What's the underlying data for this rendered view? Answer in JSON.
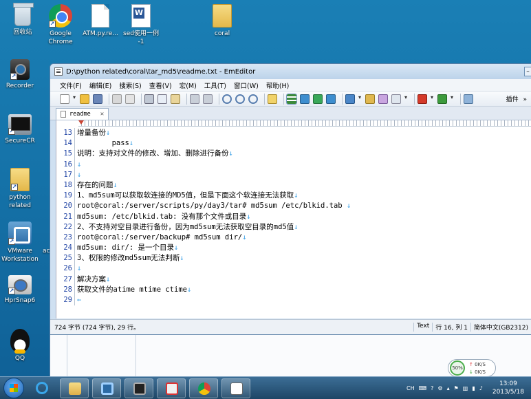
{
  "desktop": {
    "icons": [
      {
        "id": "recycle-bin",
        "label": "回收站",
        "icon": "recycle-bin-icon"
      },
      {
        "id": "chrome",
        "label": "Google\nChrome",
        "icon": "chrome-icon"
      },
      {
        "id": "atm",
        "label": "ATM.py.re...",
        "icon": "document-icon"
      },
      {
        "id": "sed",
        "label": "sed使用一例\n-1",
        "icon": "word-document-icon"
      },
      {
        "id": "coral",
        "label": "coral",
        "icon": "folder-icon"
      },
      {
        "id": "recorder",
        "label": "Recorder",
        "icon": "camcorder-icon"
      },
      {
        "id": "securecrt",
        "label": "SecureCR",
        "icon": "terminal-icon"
      },
      {
        "id": "python",
        "label": "python\nrelated",
        "icon": "folder-icon"
      },
      {
        "id": "vmware",
        "label": "VMware\nWorkstation",
        "icon": "vmware-icon"
      },
      {
        "id": "hprsnap",
        "label": "HprSnap6",
        "icon": "camera-icon"
      },
      {
        "id": "qq",
        "label": "QQ",
        "icon": "penguin-icon"
      }
    ],
    "partial_label": "ac"
  },
  "editor_window": {
    "title": "D:\\python related\\coral\\tar_md5\\readme.txt - EmEditor",
    "menu": [
      "文件(F)",
      "编辑(E)",
      "搜索(S)",
      "查看(V)",
      "宏(M)",
      "工具(T)",
      "窗口(W)",
      "帮助(H)"
    ],
    "toolbar_plugins_label": "插件",
    "overflow_chevron": "»",
    "tab": {
      "label": "readme",
      "close": "✕"
    },
    "lines": [
      {
        "n": "13",
        "text": "增量备份",
        "eol": "↓"
      },
      {
        "n": "14",
        "text": "        pass",
        "eol": "↓"
      },
      {
        "n": "15",
        "text": "说明：支持对文件的修改、增加、删除进行备份",
        "eol": "↓"
      },
      {
        "n": "16",
        "text": "",
        "eol": "↓"
      },
      {
        "n": "17",
        "text": "",
        "eol": "↓"
      },
      {
        "n": "18",
        "text": "存在的问题",
        "eol": "↓"
      },
      {
        "n": "19",
        "text": "1、md5sum可以获取软连接的MD5值，但是下面这个软连接无法获取",
        "eol": "↓"
      },
      {
        "n": "20",
        "text": "root@coral:/server/scripts/py/day3/tar# md5sum /etc/blkid.tab ",
        "eol": "↓"
      },
      {
        "n": "21",
        "text": "md5sum: /etc/blkid.tab: 没有那个文件或目录",
        "eol": "↓"
      },
      {
        "n": "22",
        "text": "2、不支持对空目录进行备份，因为md5sum无法获取空目录的md5值",
        "eol": "↓"
      },
      {
        "n": "23",
        "text": "root@coral:/server/backup# md5sum dir/",
        "eol": "↓"
      },
      {
        "n": "24",
        "text": "md5sum: dir/: 是一个目录",
        "eol": "↓"
      },
      {
        "n": "25",
        "text": "3、权限的修改md5sum无法判断",
        "eol": "↓"
      },
      {
        "n": "26",
        "text": "",
        "eol": "↓"
      },
      {
        "n": "27",
        "text": "解决方案",
        "eol": "↓"
      },
      {
        "n": "28",
        "text": "获取文件的atime mtime ctime",
        "eol": "↓"
      },
      {
        "n": "29",
        "text": "",
        "eol": "←"
      }
    ],
    "status": {
      "left": "724 字节 (724 字节), 29 行。",
      "mode": "Text",
      "position": "行 16, 列 1",
      "encoding": "简体中文(GB2312)"
    }
  },
  "net_widget": {
    "percent": "50%",
    "up": "0K/S",
    "down": "0K/S"
  },
  "taskbar": {
    "buttons": [
      {
        "id": "ie",
        "icon": "internet-explorer-icon",
        "open": false
      },
      {
        "id": "explorer",
        "icon": "folder-icon",
        "open": true
      },
      {
        "id": "vmware",
        "icon": "vmware-icon",
        "open": true
      },
      {
        "id": "securecrt",
        "icon": "terminal-icon",
        "open": true
      },
      {
        "id": "hprsnap",
        "icon": "camera-icon",
        "open": true
      },
      {
        "id": "chrome",
        "icon": "chrome-icon",
        "open": true
      },
      {
        "id": "emeditor",
        "icon": "notepad-icon",
        "open": true
      }
    ],
    "tray": {
      "lang": "CH"
    },
    "clock": {
      "time": "13:09",
      "date": "2013/5/18"
    }
  },
  "colors": {
    "accent": "#1572a8",
    "line_numbers": "#2346a5",
    "eol_marks": "#3aa0e6"
  }
}
